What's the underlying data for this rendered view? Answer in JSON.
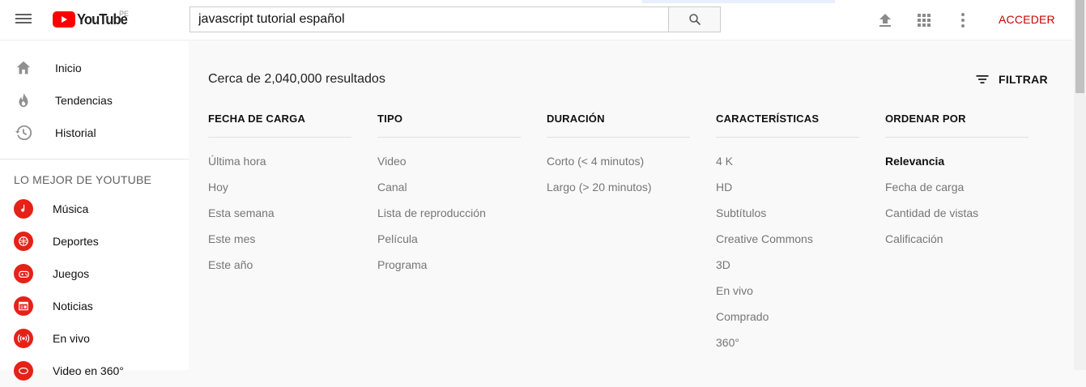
{
  "header": {
    "logo_text": "YouTube",
    "region": "PE",
    "search_value": "javascript tutorial español",
    "signin_label": "ACCEDER",
    "accent_color": "#cc0000",
    "icons": [
      "menu-icon",
      "search-icon",
      "upload-icon",
      "apps-icon",
      "more-vert-icon"
    ]
  },
  "sidebar": {
    "main_items": [
      {
        "label": "Inicio",
        "icon": "home-icon"
      },
      {
        "label": "Tendencias",
        "icon": "fire-icon"
      },
      {
        "label": "Historial",
        "icon": "history-icon"
      }
    ],
    "section_title": "LO MEJOR DE YOUTUBE",
    "categories": [
      {
        "label": "Música",
        "icon": "music-icon"
      },
      {
        "label": "Deportes",
        "icon": "sports-icon"
      },
      {
        "label": "Juegos",
        "icon": "gamepad-icon"
      },
      {
        "label": "Noticias",
        "icon": "news-icon"
      },
      {
        "label": "En vivo",
        "icon": "live-icon"
      },
      {
        "label": "Video en 360°",
        "icon": "360-icon"
      }
    ]
  },
  "results": {
    "count_text": "Cerca de 2,040,000 resultados",
    "filter_label": "FILTRAR"
  },
  "filters": [
    {
      "title": "FECHA DE CARGA",
      "options": [
        "Última hora",
        "Hoy",
        "Esta semana",
        "Este mes",
        "Este año"
      ]
    },
    {
      "title": "TIPO",
      "options": [
        "Video",
        "Canal",
        "Lista de reproducción",
        "Película",
        "Programa"
      ]
    },
    {
      "title": "DURACIÓN",
      "options": [
        "Corto (< 4 minutos)",
        "Largo (> 20 minutos)"
      ]
    },
    {
      "title": "CARACTERÍSTICAS",
      "options": [
        "4 K",
        "HD",
        "Subtítulos",
        "Creative Commons",
        "3D",
        "En vivo",
        "Comprado",
        "360°"
      ]
    },
    {
      "title": "ORDENAR POR",
      "options": [
        "Relevancia",
        "Fecha de carga",
        "Cantidad de vistas",
        "Calificación"
      ],
      "selected": "Relevancia"
    }
  ]
}
